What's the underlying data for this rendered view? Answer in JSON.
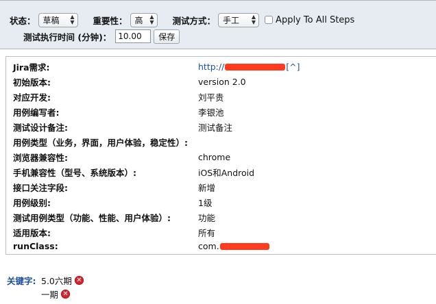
{
  "toolbar": {
    "status_label": "状态：",
    "status_value": "草稿",
    "importance_label": "重要性：",
    "importance_value": "高",
    "method_label": "测试方式：",
    "method_value": "手工",
    "apply_all_label": "Apply To All Steps",
    "apply_all_checked": false,
    "exec_time_label": "测试执行时间 (分钟)：",
    "exec_time_value": "10.00",
    "save_label": "保存"
  },
  "fields": [
    {
      "label": "Jira需求:",
      "value_prefix": "http://",
      "value_suffix": "[^]",
      "redacted": true
    },
    {
      "label": "初始版本:",
      "value": "version 2.0"
    },
    {
      "label": "对应开发:",
      "value": "刘平贵"
    },
    {
      "label": "用例编写者:",
      "value": "李银池"
    },
    {
      "label": "测试设计备注:",
      "value": "测试备注"
    },
    {
      "label": "用例类型（业务，界面，用户体验，稳定性）:",
      "value": ""
    },
    {
      "label": "浏览器兼容性:",
      "value": "chrome"
    },
    {
      "label": "手机兼容性（型号、系统版本）:",
      "value": "iOS和Android"
    },
    {
      "label": "接口关注字段:",
      "value": "新增"
    },
    {
      "label": "用例级别:",
      "value": "1级"
    },
    {
      "label": "测试用例类型（功能、性能、用户体验）:",
      "value": "功能"
    },
    {
      "label": "适用版本:",
      "value": "所有"
    },
    {
      "label": "runClass:",
      "value_prefix": "com.",
      "redacted": true
    }
  ],
  "keywords": {
    "label": "关键字:",
    "items": [
      "5.0六期",
      "一期"
    ]
  },
  "colors": {
    "toolbar_bg": "#e6ecf2",
    "link": "#1a4f9a",
    "remove_icon": "#d9242b",
    "redaction": "#ff3b1f"
  }
}
